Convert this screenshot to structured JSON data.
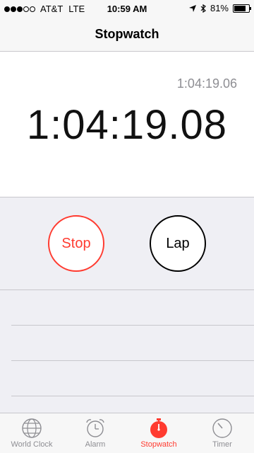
{
  "status_bar": {
    "carrier": "AT&T",
    "network": "LTE",
    "time": "10:59 AM",
    "battery": "81%",
    "battery_level": 0.81
  },
  "nav": {
    "title": "Stopwatch"
  },
  "stopwatch": {
    "lap_time": "1:04:19.06",
    "main_time": "1:04:19.08"
  },
  "controls": {
    "stop_label": "Stop",
    "lap_label": "Lap"
  },
  "tabs": [
    {
      "label": "World Clock",
      "icon": "globe-icon",
      "active": false
    },
    {
      "label": "Alarm",
      "icon": "alarm-clock-icon",
      "active": false
    },
    {
      "label": "Stopwatch",
      "icon": "stopwatch-icon",
      "active": true
    },
    {
      "label": "Timer",
      "icon": "timer-icon",
      "active": false
    }
  ],
  "colors": {
    "accent": "#ff3b30",
    "background": "#efeff4",
    "separator": "#c8c7cc",
    "inactive": "#8e8e93"
  }
}
